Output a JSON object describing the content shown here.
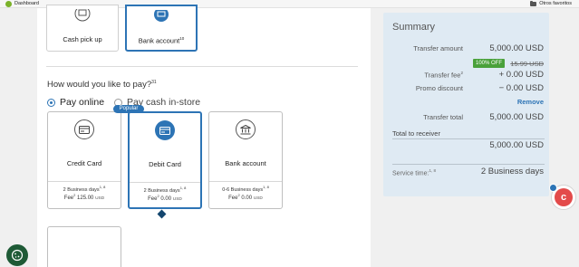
{
  "bookmarks": {
    "left_label": "Dashboard",
    "right_label": "Otros favoritos"
  },
  "delivery": {
    "cash_pickup": "Cash pick up",
    "bank_account": "Bank account",
    "bank_account_sup": "10"
  },
  "payment": {
    "question": "How would you like to pay?",
    "question_sup": "31",
    "options": [
      {
        "label": "Pay online",
        "selected": true
      },
      {
        "label": "Pay cash in-store",
        "selected": false
      }
    ],
    "popular_badge": "Popular",
    "cards": [
      {
        "title": "Credit Card",
        "days": "2 Business days",
        "days_sup": "1, 8",
        "fee_label": "Fee",
        "fee_sup": "2",
        "fee_value": "125.00",
        "currency": "USD",
        "icon": "card-icon"
      },
      {
        "title": "Debit Card",
        "days": "2 Business days",
        "days_sup": "1, 8",
        "fee_label": "Fee",
        "fee_sup": "2",
        "fee_value": "0.00",
        "currency": "USD",
        "icon": "card-icon"
      },
      {
        "title": "Bank account",
        "days": "0-6 Business days",
        "days_sup": "1, 8",
        "fee_label": "Fee",
        "fee_sup": "2",
        "fee_value": "0.00",
        "currency": "USD",
        "icon": "bank-icon"
      }
    ]
  },
  "summary": {
    "title": "Summary",
    "transfer_amount_label": "Transfer amount",
    "transfer_amount_value": "5,000.00 USD",
    "discount_badge": "100% OFF",
    "original_fee": "15.99 USD",
    "transfer_fee_label": "Transfer fee",
    "transfer_fee_sup": "2",
    "transfer_fee_value": "+ 0.00 USD",
    "promo_label": "Promo discount",
    "promo_value": "− 0.00 USD",
    "remove_label": "Remove",
    "transfer_total_label": "Transfer total",
    "transfer_total_value": "5,000.00 USD",
    "total_receiver_label": "Total  to receiver",
    "total_receiver_value": "5,000.00 USD",
    "service_time_label": "Service time:",
    "service_time_sup": "1, 8",
    "service_time_value": "2 Business days"
  },
  "colors": {
    "accent": "#2d74b5",
    "badge_green": "#4aa13b",
    "summary_bg": "#dfeaf3"
  }
}
